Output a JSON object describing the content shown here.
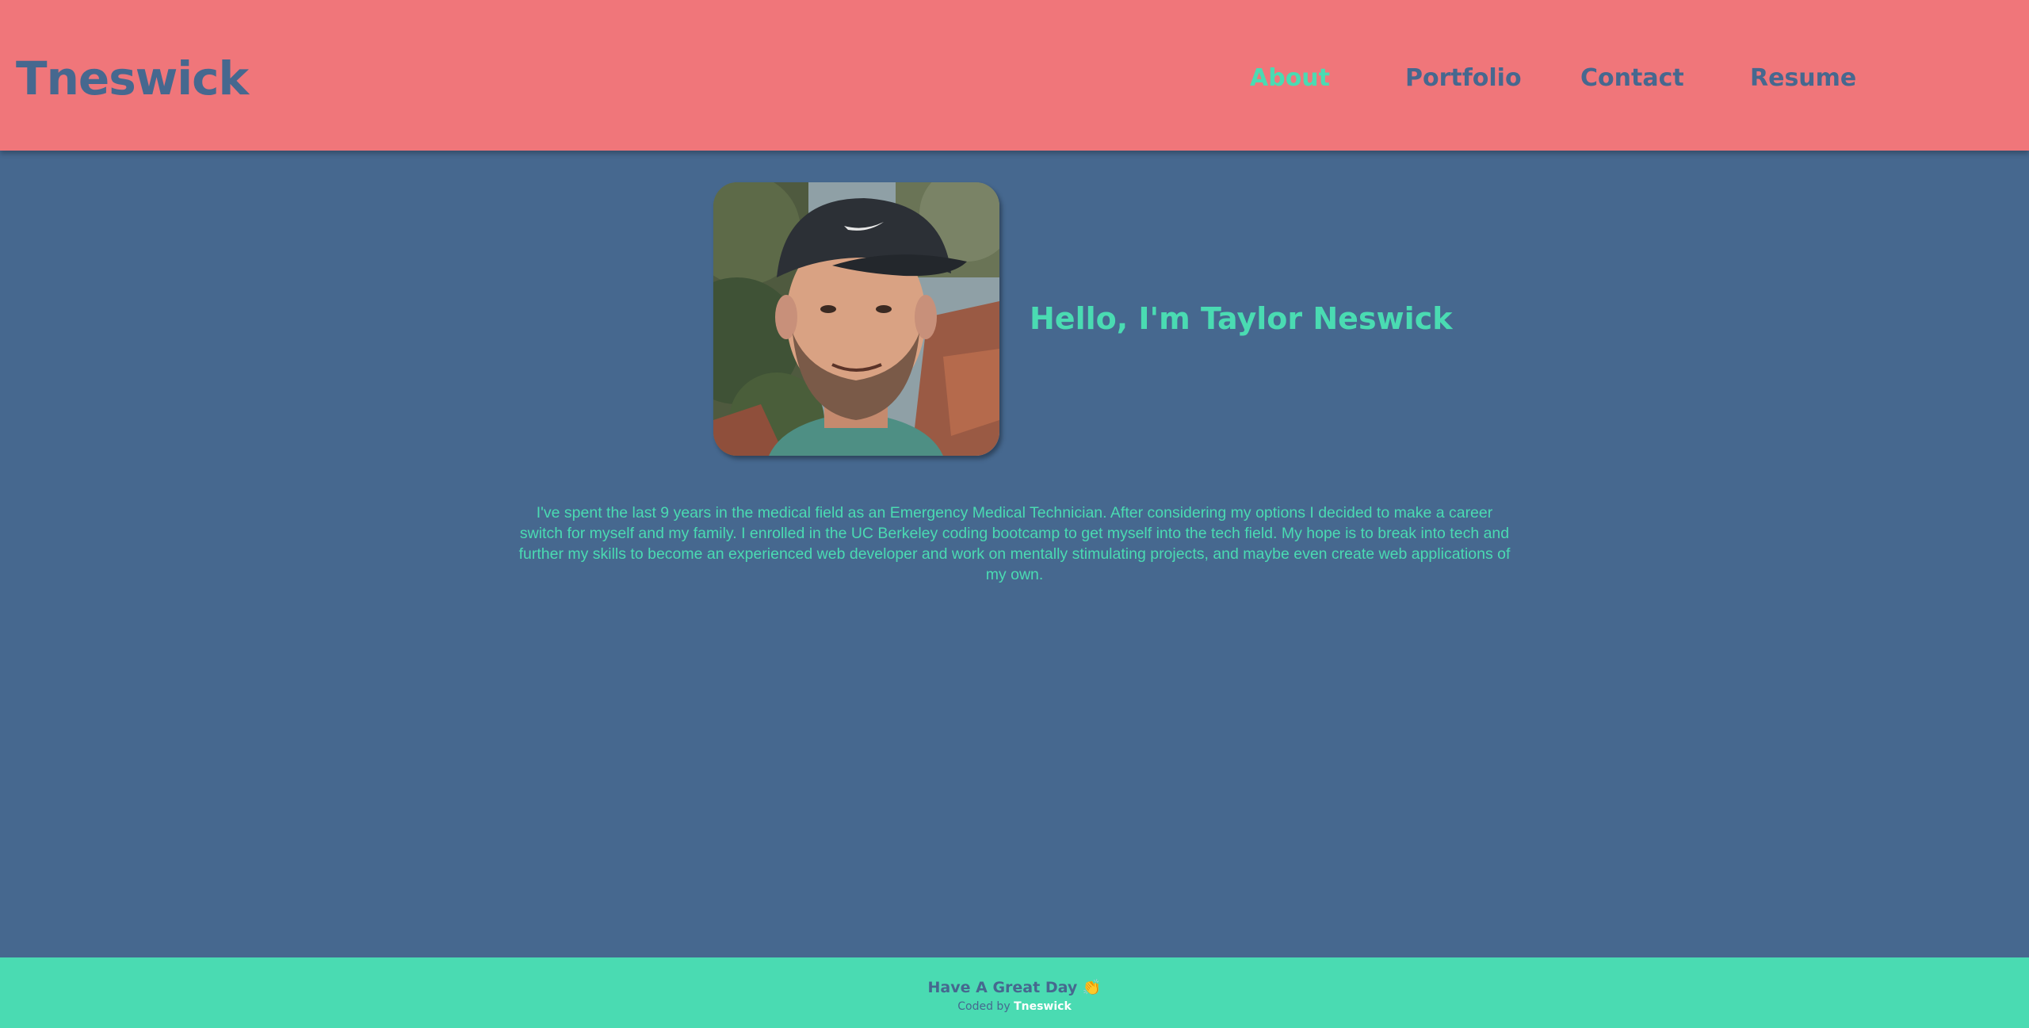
{
  "header": {
    "brand": "Tneswick",
    "nav": [
      {
        "label": "About",
        "active": true
      },
      {
        "label": "Portfolio",
        "active": false
      },
      {
        "label": "Contact",
        "active": false
      },
      {
        "label": "Resume",
        "active": false
      }
    ]
  },
  "about": {
    "greeting": "Hello, I'm Taylor Neswick",
    "bio": "I've spent the last 9 years in the medical field as an Emergency Medical Technician. After considering my options I decided to make a career switch for myself and my family. I enrolled in the UC Berkeley coding bootcamp to get myself into the tech field. My hope is to break into tech and further my skills to become an experienced web developer and work on mentally stimulating projects, and maybe even create web applications of my own."
  },
  "footer": {
    "message": "Have A Great Day 👏",
    "credit_prefix": "Coded by ",
    "credit_name": "Tneswick"
  },
  "colors": {
    "header_bg": "#f0767a",
    "page_bg": "#46688f",
    "accent": "#4adbb2",
    "footer_bg": "#4adbb2",
    "nav_text": "#46688f"
  }
}
